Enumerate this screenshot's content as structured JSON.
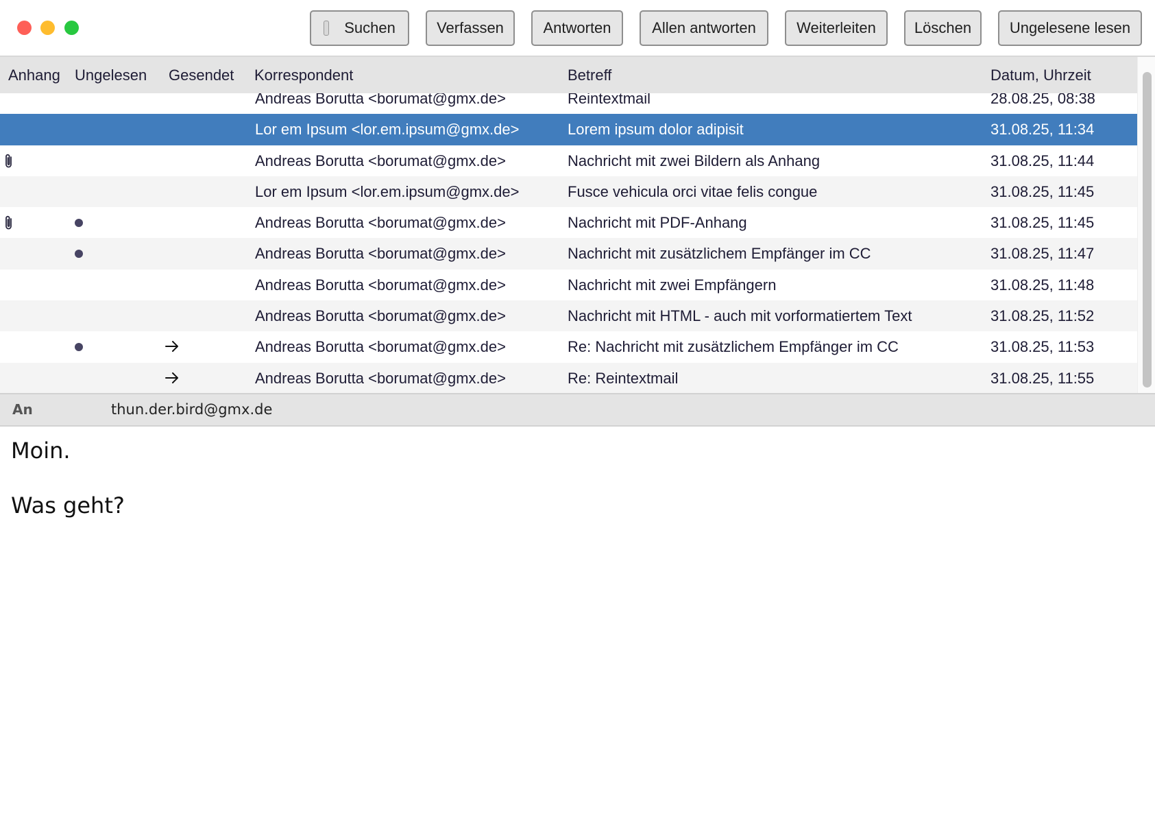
{
  "toolbar": {
    "buttons": [
      "Suchen",
      "Verfassen",
      "Antworten",
      "Allen antworten",
      "Weiterleiten",
      "Löschen",
      "Ungelesene lesen"
    ]
  },
  "columns": [
    "Anhang",
    "Ungelesen",
    "Gesendet",
    "Korrespondent",
    "Betreff",
    "Datum, Uhrzeit"
  ],
  "messages": [
    {
      "attachment": false,
      "unread": false,
      "sent": false,
      "correspondent": "Andreas Borutta <borumat@gmx.de>",
      "subject": "Reintextmail",
      "date": "28.08.25, 08:38"
    },
    {
      "attachment": false,
      "unread": false,
      "sent": false,
      "correspondent": "Lor em Ipsum <lor.em.ipsum@gmx.de>",
      "subject": "Lorem ipsum dolor adipisit",
      "date": "31.08.25, 11:34",
      "selected": true
    },
    {
      "attachment": true,
      "unread": false,
      "sent": false,
      "correspondent": "Andreas Borutta <borumat@gmx.de>",
      "subject": "Nachricht mit zwei Bildern als Anhang",
      "date": "31.08.25, 11:44"
    },
    {
      "attachment": false,
      "unread": false,
      "sent": false,
      "correspondent": "Lor em Ipsum <lor.em.ipsum@gmx.de>",
      "subject": "Fusce vehicula orci vitae felis congue",
      "date": "31.08.25, 11:45"
    },
    {
      "attachment": true,
      "unread": true,
      "sent": false,
      "correspondent": "Andreas Borutta <borumat@gmx.de>",
      "subject": "Nachricht mit PDF-Anhang",
      "date": "31.08.25, 11:45"
    },
    {
      "attachment": false,
      "unread": true,
      "sent": false,
      "correspondent": "Andreas Borutta <borumat@gmx.de>",
      "subject": "Nachricht mit zusätzlichem Empfänger im CC",
      "date": "31.08.25, 11:47"
    },
    {
      "attachment": false,
      "unread": false,
      "sent": false,
      "correspondent": "Andreas Borutta <borumat@gmx.de>",
      "subject": "Nachricht mit zwei Empfängern",
      "date": "31.08.25, 11:48"
    },
    {
      "attachment": false,
      "unread": false,
      "sent": false,
      "correspondent": "Andreas Borutta <borumat@gmx.de>",
      "subject": "Nachricht mit HTML - auch mit vorformatiertem Text",
      "date": "31.08.25, 11:52"
    },
    {
      "attachment": false,
      "unread": true,
      "sent": true,
      "correspondent": "Andreas Borutta <borumat@gmx.de>",
      "subject": "Re: Nachricht mit zusätzlichem Empfänger im CC",
      "date": "31.08.25, 11:53"
    },
    {
      "attachment": false,
      "unread": false,
      "sent": true,
      "correspondent": "Andreas Borutta <borumat@gmx.de>",
      "subject": "Re: Reintextmail",
      "date": "31.08.25, 11:55"
    }
  ],
  "preview": {
    "to_label": "An",
    "to_value": "thun.der.bird@gmx.de",
    "body": [
      "Moin.",
      "Was geht?"
    ]
  },
  "colors": {
    "selection": "#417dbd",
    "close": "#fe5f57",
    "minimize": "#febc2e",
    "zoom": "#28c840"
  }
}
